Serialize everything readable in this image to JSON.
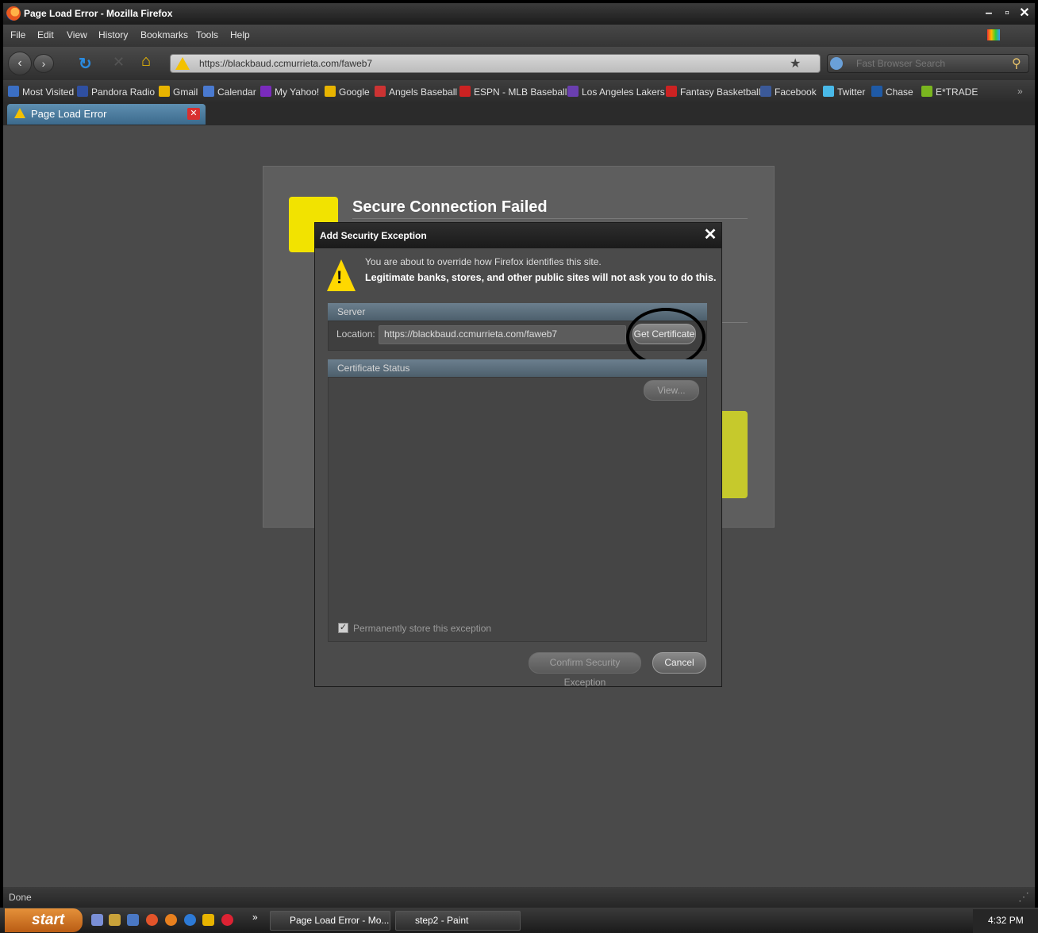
{
  "window": {
    "title": "Page Load Error - Mozilla Firefox"
  },
  "menu": [
    "File",
    "Edit",
    "View",
    "History",
    "Bookmarks",
    "Tools",
    "Help"
  ],
  "address_bar": {
    "url": "https://blackbaud.ccmurrieta.com/faweb7"
  },
  "search_bar": {
    "placeholder": "Fast Browser Search"
  },
  "bookmarks": [
    {
      "label": "Most Visited",
      "color": "#3b6fc4"
    },
    {
      "label": "Pandora Radio",
      "color": "#2f4fa0"
    },
    {
      "label": "Gmail",
      "color": "#e8b400"
    },
    {
      "label": "Calendar",
      "color": "#4a7ad0"
    },
    {
      "label": "My Yahoo!",
      "color": "#7a2bbd"
    },
    {
      "label": "Google",
      "color": "#e8b400"
    },
    {
      "label": "Angels Baseball",
      "color": "#c33"
    },
    {
      "label": "ESPN - MLB Baseball",
      "color": "#c22"
    },
    {
      "label": "Los Angeles Lakers",
      "color": "#6a3fb0"
    },
    {
      "label": "Fantasy Basketball",
      "color": "#c22"
    },
    {
      "label": "Facebook",
      "color": "#3b5998"
    },
    {
      "label": "Twitter",
      "color": "#49b9e8"
    },
    {
      "label": "Chase",
      "color": "#1f5aa6"
    },
    {
      "label": "E*TRADE",
      "color": "#7ab61f"
    }
  ],
  "tab": {
    "label": "Page Load Error"
  },
  "error_page": {
    "title": "Secure Connection Failed"
  },
  "dialog": {
    "title": "Add Security Exception",
    "message_line1": "You are about to override how Firefox identifies this site.",
    "message_line2": "Legitimate banks, stores, and other public sites will not ask you to do this.",
    "server_group": "Server",
    "location_label": "Location:",
    "location_value": "https://blackbaud.ccmurrieta.com/faweb7",
    "get_certificate": "Get Certificate",
    "certificate_status_group": "Certificate Status",
    "view_button": "View...",
    "permanent_checkbox": "Permanently store this exception",
    "permanent_checked": true,
    "confirm_button": "Confirm Security Exception",
    "cancel_button": "Cancel"
  },
  "status_bar": {
    "text": "Done"
  },
  "taskbar": {
    "start": "start",
    "tasks": [
      "Page Load Error - Mo...",
      "step2 - Paint"
    ],
    "clock": "4:32 PM"
  }
}
